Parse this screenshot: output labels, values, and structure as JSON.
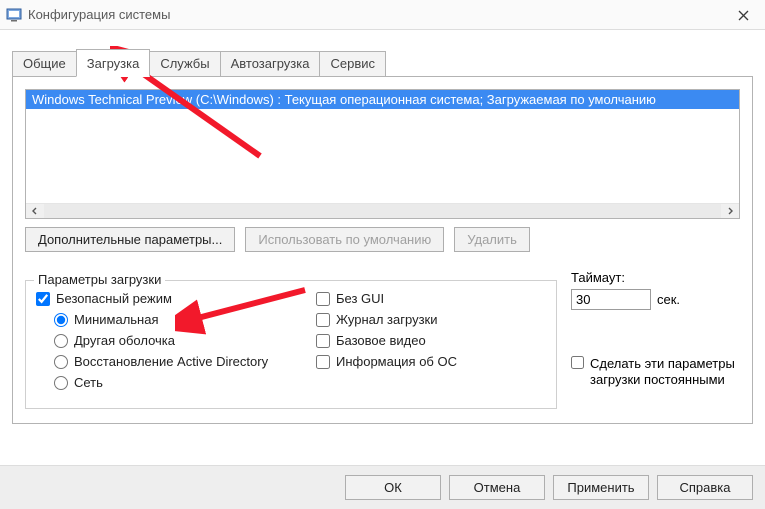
{
  "titlebar": {
    "title": "Конфигурация системы"
  },
  "tabs": {
    "general": "Общие",
    "boot": "Загрузка",
    "services": "Службы",
    "startup": "Автозагрузка",
    "tools": "Сервис"
  },
  "boot_list": {
    "entry": "Windows Technical Preview (C:\\Windows) : Текущая операционная система; Загружаемая по умолчанию"
  },
  "buttons": {
    "advanced": "Дополнительные параметры...",
    "default": "Использовать по умолчанию",
    "delete": "Удалить"
  },
  "group": {
    "legend": "Параметры загрузки",
    "safe_mode": "Безопасный режим",
    "minimal": "Минимальная",
    "altshell": "Другая оболочка",
    "adrepair": "Восстановление Active Directory",
    "network": "Сеть",
    "nogui": "Без GUI",
    "bootlog": "Журнал загрузки",
    "basevideo": "Базовое видео",
    "osinfo": "Информация  об ОС"
  },
  "timeout": {
    "label": "Таймаут:",
    "value": "30",
    "unit": "сек."
  },
  "permanent": "Сделать эти параметры загрузки постоянными",
  "dlg": {
    "ok": "ОК",
    "cancel": "Отмена",
    "apply": "Применить",
    "help": "Справка"
  }
}
